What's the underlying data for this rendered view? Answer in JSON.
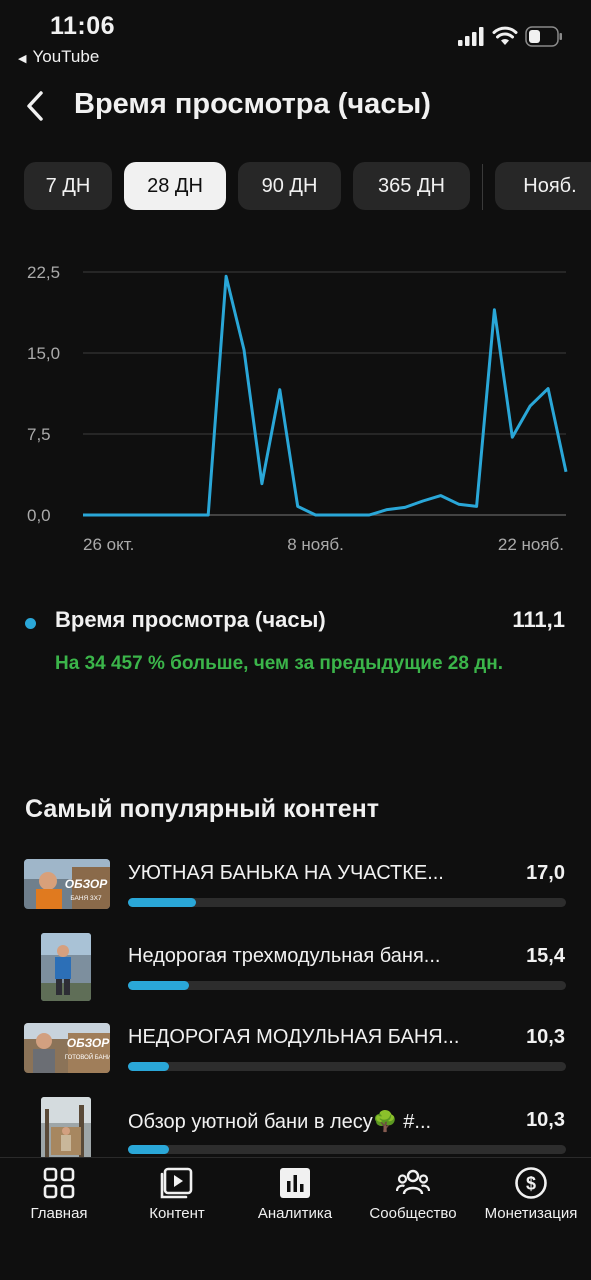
{
  "status": {
    "time": "11:06",
    "back_app": "YouTube"
  },
  "header": {
    "title": "Время просмотра (часы)"
  },
  "chips": [
    {
      "label": "7 ДН",
      "active": false
    },
    {
      "label": "28 ДН",
      "active": true
    },
    {
      "label": "90 ДН",
      "active": false
    },
    {
      "label": "365 ДН",
      "active": false
    },
    {
      "label": "Нояб.",
      "active": false
    }
  ],
  "colors": {
    "accent": "#2aa7d8",
    "positive": "#3bb54a",
    "background": "#0f0f0f",
    "chip": "#272727"
  },
  "chart_data": {
    "type": "line",
    "x_tick_labels": [
      "26 окт.",
      "8 нояб.",
      "22 нояб."
    ],
    "y_tick_labels": [
      "0,0",
      "7,5",
      "15,0",
      "22,5"
    ],
    "ylim": [
      0,
      22.5
    ],
    "grid": true,
    "series": [
      {
        "values": [
          0,
          0,
          0,
          0,
          0,
          0,
          0,
          0,
          22.1,
          15.3,
          2.9,
          11.6,
          0.8,
          0,
          0,
          0,
          0,
          0.5,
          0.7,
          1.3,
          1.8,
          1.0,
          0.8,
          19.0,
          7.2,
          10.1,
          11.7,
          4.0
        ],
        "x_start": 0,
        "x_label_positions": [
          0,
          13,
          27
        ]
      }
    ]
  },
  "metric": {
    "label": "Время просмотра (часы)",
    "value": "111,1",
    "delta": "На 34 457 % больше, чем за предыдущие 28 дн."
  },
  "top_content": {
    "title": "Самый популярный контент",
    "items": [
      {
        "title": "УЮТНАЯ БАНЬКА НА УЧАСТКЕ...",
        "value": "17,0",
        "fraction": 0.155,
        "thumb": "wide",
        "thumb_text": "ОБЗОР",
        "thumb_sub": "БАНЯ 3Х7"
      },
      {
        "title": "Недорогая трехмодульная баня...",
        "value": "15,4",
        "fraction": 0.14,
        "thumb": "tall",
        "thumb_text": "",
        "thumb_sub": ""
      },
      {
        "title": "НЕДОРОГАЯ МОДУЛЬНАЯ БАНЯ...",
        "value": "10,3",
        "fraction": 0.094,
        "thumb": "wide",
        "thumb_text": "ОБЗОР",
        "thumb_sub": "ГОТОВОЙ БАНИ"
      },
      {
        "title": "Обзор уютной бани в лесу🌳 #...",
        "value": "10,3",
        "fraction": 0.094,
        "thumb": "tall",
        "thumb_text": "",
        "thumb_sub": ""
      }
    ]
  },
  "nav": {
    "items": [
      {
        "label": "Главная",
        "icon": "grid-icon"
      },
      {
        "label": "Контент",
        "icon": "play-library-icon"
      },
      {
        "label": "Аналитика",
        "icon": "bar-chart-icon"
      },
      {
        "label": "Сообщество",
        "icon": "people-icon"
      },
      {
        "label": "Монетизация",
        "icon": "dollar-icon"
      }
    ]
  }
}
